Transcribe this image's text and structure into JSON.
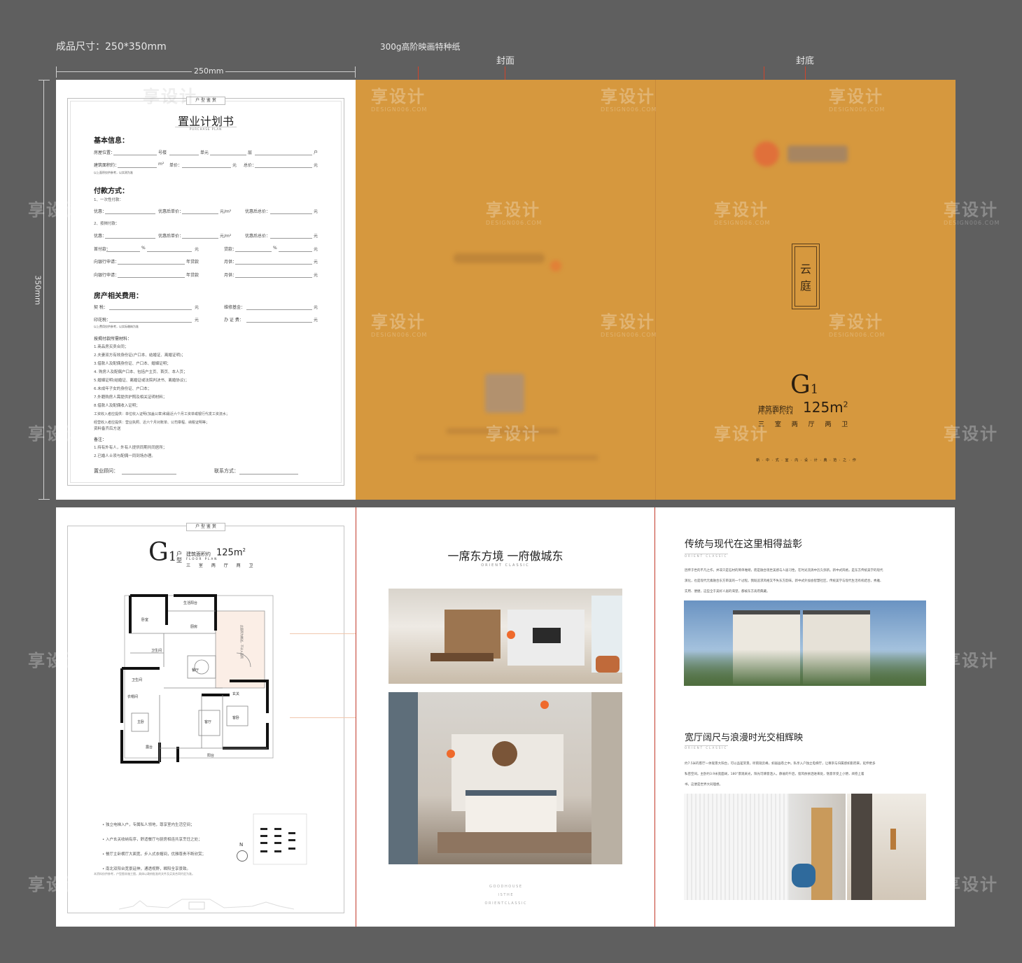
{
  "spec": {
    "finished_size": "成品尺寸：250*350mm",
    "paper": "300g高阶映画特种纸",
    "cover_label": "封面",
    "back_label": "封底",
    "width_dim": "250mm",
    "height_dim": "350mm"
  },
  "form": {
    "tag": "户 型 鉴 赏",
    "title": "置业计划书",
    "subtitle": "PURCHASE PLAN",
    "basic_title": "基本信息：",
    "basic_rows": [
      [
        "房屋位置：",
        "号楼",
        "单元",
        "层",
        "户"
      ],
      [
        "建筑面积约：",
        "m²",
        "单价：",
        "元",
        "总价：",
        "元"
      ]
    ],
    "note_small": "以上面积仅供参考，以实测为准",
    "pay_title": "付款方式：",
    "pay_one": "1、一次性付款：",
    "pay_one_row": [
      "优惠：",
      "优惠后单价：",
      "元/m²",
      "优惠后总价：",
      "元"
    ],
    "pay_two": "2、按揭付款：",
    "pay_two_row": [
      "优惠：",
      "优惠后单价：",
      "元/m²",
      "优惠后总价：",
      "元"
    ],
    "pay_rows": [
      [
        "首付款：",
        "%",
        "元",
        "贷款：",
        "%",
        "元"
      ],
      [
        "向银行申请：",
        "年贷款",
        "月供：",
        "元"
      ],
      [
        "向银行申请：",
        "年贷款",
        "月供：",
        "元"
      ]
    ],
    "fee_title": "房产相关费用：",
    "fee_rows": [
      [
        "契  税：",
        "元",
        "维修基金：",
        "元"
      ],
      [
        "印花税：",
        "元",
        "办 证 费：",
        "元"
      ]
    ],
    "fee_note": "以上费用仅供参考，以实际缴纳为准",
    "doc_title": "按揭付款所需材料：",
    "docs": [
      "1.商品房买卖合同；",
      "2.夫妻双方有效身份证(户口本、结婚证、离婚证明)；",
      "3.借款人及配偶身份证、户口本、婚姻证明；",
      "4. 购房人及配偶户口本、包括户主页、首页、本人页；",
      "5.婚姻证明(结婚证、离婚证或法院判决书、离婚协议)；",
      "6.未成年子女的身份证、户口本；",
      "7.外籍购房人需提供护照及相关证明材料；",
      "8.借款人及配偶收入证明；",
      "工资收入者应提供：单位收入证明(加盖公章)和最近六个月工资单或银行代发工资流水；",
      "经营收入者应提供：营业执照、近六个月对账单、公司章程、纳税证明等；",
      "资料备齐后方送"
    ],
    "remarks_title": "备注：",
    "remarks": [
      "1.持有外有人，外有人提供同期共同居所；",
      "2.已婚人士须与配偶一同到场办理。"
    ],
    "consultant": "置业顾问：",
    "contact": "联系方式："
  },
  "back_cover": {
    "brand_blurred": "品牌",
    "name_vertical": [
      "云",
      "庭"
    ],
    "unit": "G",
    "unit_sub": "1",
    "area_label": "建筑面积约",
    "floor_plan_en": "FLOOR PLAN",
    "area_value": "125m",
    "area_sup": "2",
    "rooms": "三 室 两 厅 两 卫",
    "bottom_line": "新 · 中 · 式 · 室 · 内 · 设 · 计 · 典 · 范 · 之 · 作"
  },
  "floorplan": {
    "tag": "户 型 鉴 赏",
    "unit": "G",
    "unit_sub": "1",
    "unit_side": "户型",
    "area_label": "建筑面积约",
    "floor_plan_en": "FLOOR PLAN",
    "area_value": "125m",
    "area_sup": "2",
    "rooms": "三 室 两 厅 两 卫",
    "bullets": [
      "独立电梯入户，专属私人领地，尊享室内生活空间；",
      "入户玄关收纳有序，舒适餐厅与厨房相连共享烹饪之处；",
      "餐厅主卧横厅大面宽，步入式衣帽间，优雅尊贵不断欣赏；",
      "南北双阳台宽景延伸，通透视野，瞬阳全享景致。"
    ],
    "north": "N",
    "room_labels": {
      "r1": "卧室",
      "r2": "厨房",
      "r3": "卫生间",
      "r4": "卫生间",
      "r5": "餐厅",
      "r6": "客厅",
      "r7": "主卧",
      "r8": "客卧",
      "r9": "阳台",
      "r10": "衣帽间",
      "r11": "玄关",
      "r12": "露台",
      "r13": "生活阳台"
    },
    "terrace_note": "此面积为赠送，不计入面积",
    "disclaimer": "本资料仅供参考，户型图非施工图，具体以政府批准的文件及买卖合同约定为准。"
  },
  "middle": {
    "title": "一席东方境 一府傲城东",
    "subtitle": "ORIENT CLASSIC",
    "bottom_lines": [
      "G O O D   H O U S E",
      "I S   T H E",
      "O R I E N T   C L A S S I C"
    ]
  },
  "right": {
    "title1": "传统与现代在这里相得益彰",
    "sub1": "ORIENT CLASSIC",
    "text1": [
      "因传于世的不凡之作，并非只是石材的简单堆砌，而是融合现世美感与人居习性，在时光流淌中历久弥新。新中式风格，是东方传统美学的现代",
      "演化，也是现代元素融合东方审美的一个过程。我既追求风格又不失东方韵味。新中式外加会智慧社区，传统美学与现代生活有机结合，秀雅、",
      "实用、便捷，这些全于美好人居的渴望，都被东方高府典藏。"
    ],
    "title2": "宽厅阔尺与浪漫时光交相辉映",
    "sub2": "ORIENT CLASSIC",
    "text2": [
      "约7.5米的客厅一体观景大阳台，可以品茗赏景，听雨观云峰，如居画卷之中。私享入户独立电梯厅，让尊崇与归属感如影而来，延伸更多",
      "私密空间。主卧约3.9米宽面阔，180°景观采光，阳光可肆意洒入，静谧的午后，窗风依依洒进来处，惬意享受上小憩，阅卷上着",
      "书，这便是世界大同理想。"
    ]
  },
  "watermark": {
    "cn": "享设计",
    "en": "DESIGN006.COM"
  },
  "colors": {
    "cover": "#d6983e",
    "accent": "#ef6a2c",
    "divider": "#c23a2a",
    "background": "#5f5f5f"
  }
}
